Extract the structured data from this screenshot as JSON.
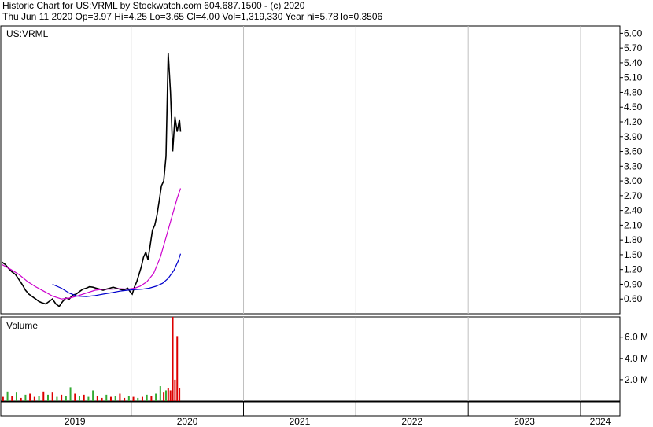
{
  "header": {
    "title": "Historic Chart for US:VRML by Stockwatch.com 604.687.1500 - (c) 2020",
    "quote": "Thu Jun 11 2020  Op=3.97  Hi=4.25  Lo=3.65  Cl=4.00  Vol=1,319,330  Year hi=5.78  lo=0.3506"
  },
  "chart_data": {
    "type": "line",
    "symbol_label": "US:VRML",
    "volume_label": "Volume",
    "x_axis_labels": [
      "2019",
      "2020",
      "2021",
      "2022",
      "2023",
      "2024"
    ],
    "price_axis": {
      "ticks": [
        0.6,
        0.9,
        1.2,
        1.5,
        1.8,
        2.1,
        2.4,
        2.7,
        3.0,
        3.3,
        3.6,
        3.9,
        4.2,
        4.5,
        4.8,
        5.1,
        5.4,
        5.7,
        6.0
      ],
      "tick_labels": [
        "0.60",
        "0.90",
        "1.20",
        "1.50",
        "1.80",
        "2.10",
        "2.40",
        "2.70",
        "3.00",
        "3.30",
        "3.60",
        "3.90",
        "4.20",
        "4.50",
        "4.80",
        "5.10",
        "5.40",
        "5.70",
        "6.00"
      ],
      "ylim": [
        0.3,
        6.15
      ]
    },
    "volume_axis": {
      "ticks": [
        2.0,
        4.0,
        6.0
      ],
      "tick_labels": [
        "2.0 M",
        "4.0 M",
        "6.0 M"
      ],
      "ylim": [
        0,
        7.9
      ]
    },
    "series": [
      {
        "color": "#000000",
        "kind": "price",
        "x": [
          2018.85,
          2018.88,
          2018.91,
          2018.94,
          2018.97,
          2019.0,
          2019.03,
          2019.06,
          2019.09,
          2019.12,
          2019.15,
          2019.18,
          2019.21,
          2019.24,
          2019.27,
          2019.3,
          2019.33,
          2019.36,
          2019.39,
          2019.42,
          2019.45,
          2019.48,
          2019.51,
          2019.54,
          2019.57,
          2019.6,
          2019.63,
          2019.66,
          2019.69,
          2019.72,
          2019.75,
          2019.78,
          2019.81,
          2019.84,
          2019.87,
          2019.9,
          2019.93,
          2019.95,
          2019.97,
          2019.99,
          2020.01,
          2020.03,
          2020.05,
          2020.07,
          2020.09,
          2020.11,
          2020.13,
          2020.15,
          2020.17,
          2020.19,
          2020.21,
          2020.23,
          2020.25,
          2020.27,
          2020.29,
          2020.31,
          2020.33,
          2020.35,
          2020.37,
          2020.39,
          2020.41,
          2020.43,
          2020.44
        ],
        "values": [
          1.35,
          1.3,
          1.22,
          1.15,
          1.1,
          1.0,
          0.9,
          0.78,
          0.7,
          0.65,
          0.6,
          0.55,
          0.52,
          0.5,
          0.55,
          0.6,
          0.5,
          0.45,
          0.55,
          0.62,
          0.6,
          0.68,
          0.7,
          0.75,
          0.8,
          0.82,
          0.85,
          0.84,
          0.82,
          0.8,
          0.78,
          0.8,
          0.82,
          0.84,
          0.82,
          0.8,
          0.78,
          0.8,
          0.82,
          0.75,
          0.7,
          0.85,
          0.95,
          1.1,
          1.25,
          1.45,
          1.55,
          1.4,
          1.7,
          2.0,
          2.1,
          2.3,
          2.6,
          2.9,
          3.0,
          3.5,
          5.6,
          4.8,
          3.6,
          4.3,
          4.0,
          4.25,
          4.0
        ]
      },
      {
        "color": "#cc00cc",
        "kind": "short_ma",
        "x": [
          2018.85,
          2018.93,
          2019.0,
          2019.08,
          2019.15,
          2019.23,
          2019.3,
          2019.38,
          2019.45,
          2019.52,
          2019.6,
          2019.68,
          2019.75,
          2019.83,
          2019.9,
          2019.97,
          2020.03,
          2020.08,
          2020.14,
          2020.2,
          2020.26,
          2020.31,
          2020.36,
          2020.41,
          2020.44
        ],
        "values": [
          1.3,
          1.2,
          1.1,
          0.95,
          0.85,
          0.75,
          0.66,
          0.6,
          0.62,
          0.66,
          0.72,
          0.78,
          0.8,
          0.8,
          0.81,
          0.8,
          0.82,
          0.86,
          0.95,
          1.12,
          1.45,
          1.85,
          2.25,
          2.65,
          2.85
        ]
      },
      {
        "color": "#0000cc",
        "kind": "long_ma",
        "x": [
          2019.3,
          2019.38,
          2019.45,
          2019.52,
          2019.6,
          2019.68,
          2019.75,
          2019.83,
          2019.9,
          2019.97,
          2020.03,
          2020.1,
          2020.16,
          2020.22,
          2020.28,
          2020.33,
          2020.38,
          2020.42,
          2020.44
        ],
        "values": [
          0.9,
          0.82,
          0.72,
          0.66,
          0.65,
          0.67,
          0.7,
          0.73,
          0.76,
          0.78,
          0.79,
          0.8,
          0.82,
          0.86,
          0.92,
          1.02,
          1.18,
          1.38,
          1.52
        ]
      }
    ],
    "volume": {
      "x": [
        2018.86,
        2018.9,
        2018.94,
        2018.98,
        2019.02,
        2019.06,
        2019.1,
        2019.14,
        2019.18,
        2019.22,
        2019.26,
        2019.3,
        2019.34,
        2019.38,
        2019.42,
        2019.46,
        2019.5,
        2019.54,
        2019.58,
        2019.62,
        2019.66,
        2019.7,
        2019.74,
        2019.78,
        2019.82,
        2019.86,
        2019.9,
        2019.94,
        2019.98,
        2020.02,
        2020.06,
        2020.1,
        2020.14,
        2020.18,
        2020.22,
        2020.26,
        2020.29,
        2020.31,
        2020.33,
        2020.35,
        2020.37,
        2020.39,
        2020.41,
        2020.43
      ],
      "values": [
        0.4,
        0.9,
        0.5,
        0.8,
        0.3,
        0.6,
        0.7,
        0.4,
        0.5,
        0.9,
        0.6,
        0.8,
        0.4,
        0.6,
        0.5,
        1.3,
        0.7,
        0.5,
        0.6,
        0.4,
        1.0,
        0.5,
        0.3,
        0.6,
        0.4,
        0.5,
        0.7,
        0.3,
        0.5,
        0.4,
        0.3,
        0.4,
        0.6,
        0.5,
        0.7,
        1.4,
        0.8,
        1.0,
        1.2,
        1.0,
        7.9,
        2.0,
        6.1,
        1.2
      ],
      "colors": [
        "r",
        "g",
        "r",
        "g",
        "r",
        "g",
        "r",
        "r",
        "g",
        "r",
        "g",
        "r",
        "g",
        "r",
        "g",
        "g",
        "r",
        "g",
        "r",
        "g",
        "g",
        "r",
        "r",
        "g",
        "r",
        "g",
        "r",
        "r",
        "g",
        "r",
        "g",
        "r",
        "g",
        "r",
        "g",
        "g",
        "r",
        "g",
        "r",
        "r",
        "r",
        "r",
        "r",
        "r"
      ]
    }
  }
}
